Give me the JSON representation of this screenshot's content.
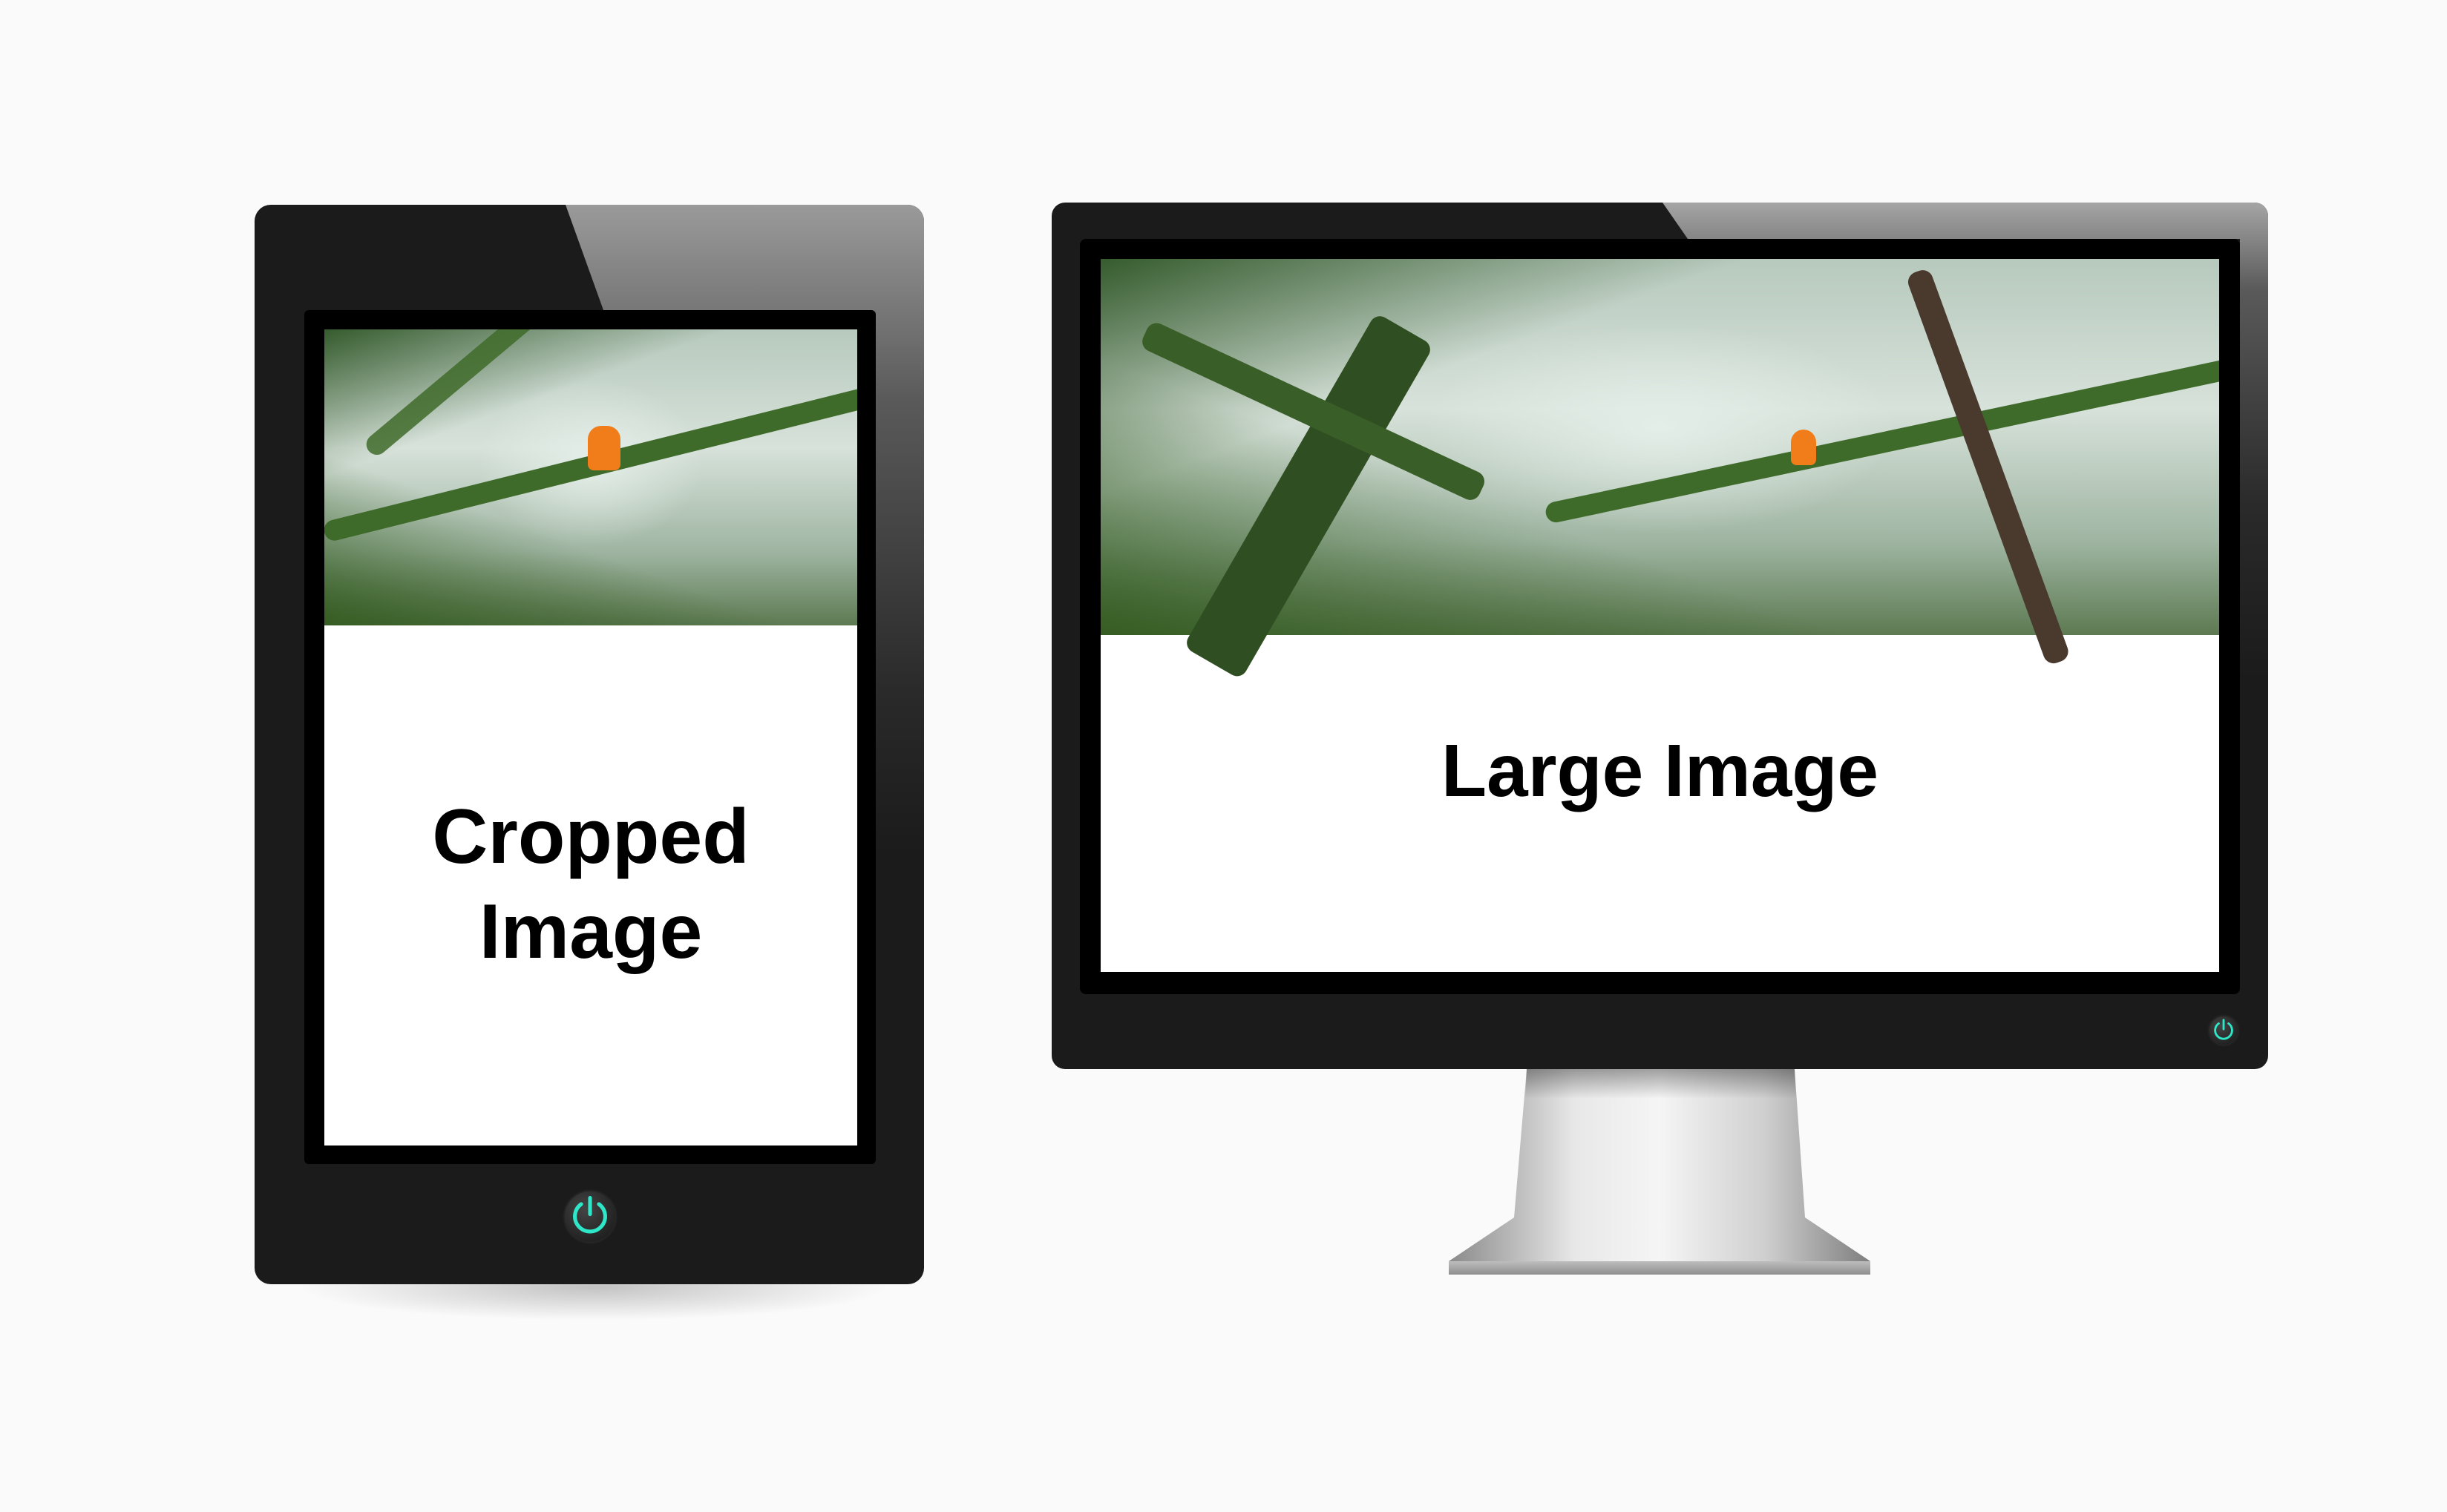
{
  "tablet": {
    "title_line1": "Cropped",
    "title_line2": "Image",
    "power_icon": "power-icon",
    "accent_color": "#2ee6c8"
  },
  "monitor": {
    "title": "Large Image",
    "power_icon": "power-icon",
    "accent_color": "#2ee6c8"
  }
}
